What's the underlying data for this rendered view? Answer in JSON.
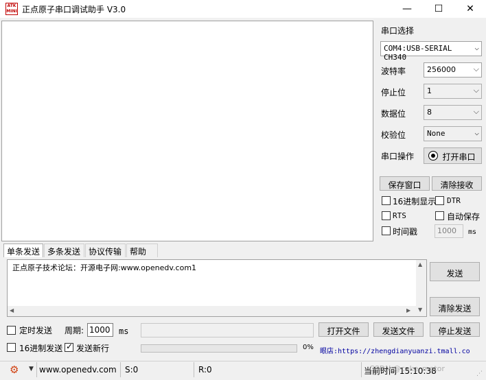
{
  "window": {
    "logo_text": "ATK\nMINI",
    "title": "正点原子串口调试助手 V3.0",
    "minimize": "—",
    "maximize": "☐",
    "close": "✕"
  },
  "port_panel": {
    "port_select_label": "串口选择",
    "port_value": "COM4:USB-SERIAL CH340",
    "baud_label": "波特率",
    "baud_value": "256000",
    "stopbits_label": "停止位",
    "stopbits_value": "1",
    "databits_label": "数据位",
    "databits_value": "8",
    "parity_label": "校验位",
    "parity_value": "None",
    "operation_label": "串口操作",
    "open_port_button": "打开串口",
    "save_window_button": "保存窗口",
    "clear_recv_button": "清除接收",
    "hex_display_label": "16进制显示",
    "dtr_label": "DTR",
    "rts_label": "RTS",
    "auto_save_label": "自动保存",
    "timestamp_label": "时间戳",
    "timestamp_value": "1000",
    "timestamp_unit": "ms"
  },
  "tabs": [
    "单条发送",
    "多条发送",
    "协议传输",
    "帮助"
  ],
  "send": {
    "text": "正点原子技术论坛：开源电子网:www.openedv.com1",
    "send_button": "发送",
    "clear_send_button": "清除发送",
    "timed_send_label": "定时发送",
    "period_label": "周期:",
    "period_value": "1000",
    "period_unit": "ms",
    "open_file_button": "打开文件",
    "send_file_button": "发送文件",
    "stop_send_button": "停止发送",
    "hex_send_label": "16进制发送",
    "send_newline_label": "发送新行",
    "progress_percent": "0%",
    "progress_fraction": 0,
    "shop_link": "眼店:https://zhengdianyuanzi.tmall.co"
  },
  "statusbar": {
    "website": "www.openedv.com",
    "sent": "S:0",
    "received": "R:0",
    "time": "当前时间 15:10:38",
    "watermark": "CSDN @cake_motor"
  }
}
